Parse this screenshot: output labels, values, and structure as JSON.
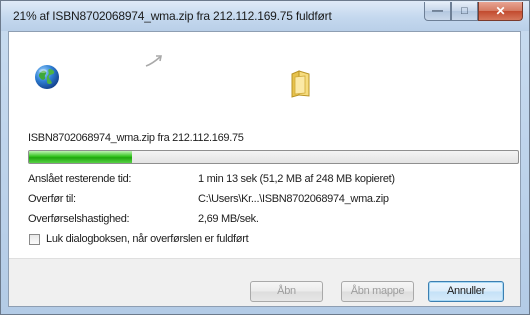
{
  "window": {
    "title": "21% af ISBN8702068974_wma.zip fra 212.112.169.75 fuldført"
  },
  "transfer": {
    "source_line": "ISBN8702068974_wma.zip fra 212.112.169.75",
    "progress_percent": 21
  },
  "details": [
    {
      "label": "Anslået resterende tid:",
      "value": "1 min 13 sek (51,2 MB af 248 MB kopieret)"
    },
    {
      "label": "Overfør til:",
      "value": "C:\\Users\\Kr...\\ISBN8702068974_wma.zip"
    },
    {
      "label": "Overførselshastighed:",
      "value": "2,69 MB/sek."
    }
  ],
  "options": {
    "close_when_done_label": "Luk dialogboksen, når overførslen er fuldført",
    "close_when_done_checked": false
  },
  "buttons": {
    "open": "Åbn",
    "open_folder": "Åbn mappe",
    "cancel": "Annuller"
  },
  "icons": {
    "globe": "globe-icon",
    "arrow": "transfer-arrow-icon",
    "folder": "folder-icon"
  },
  "colors": {
    "progress": "#34c51f",
    "titlebar": "#c4d8ee",
    "close_button": "#c24a2e"
  }
}
